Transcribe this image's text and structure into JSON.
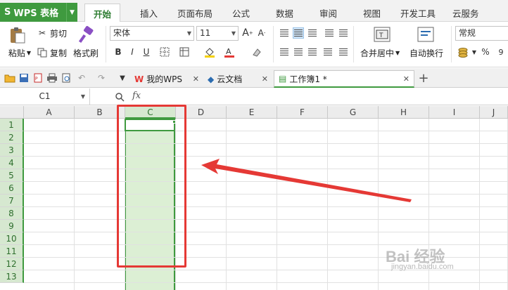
{
  "app": {
    "logo": "S",
    "title": "WPS 表格"
  },
  "menu": {
    "tabs": [
      "开始",
      "插入",
      "页面布局",
      "公式",
      "数据",
      "审阅",
      "视图",
      "开发工具",
      "云服务"
    ]
  },
  "ribbon": {
    "paste": "粘贴",
    "cut": "剪切",
    "copy": "复制",
    "format_painter": "格式刷",
    "font_name": "宋体",
    "font_size": "11",
    "bold": "B",
    "italic": "I",
    "underline": "U",
    "merge_center": "合并居中",
    "wrap_text": "自动换行",
    "number_format": "常规",
    "percent": "%",
    "comma": "9"
  },
  "doc_tabs": [
    {
      "label": "我的WPS"
    },
    {
      "label": "云文档"
    },
    {
      "label": "工作簿1 *"
    }
  ],
  "formula_bar": {
    "cell_ref": "C1",
    "fx": "fx"
  },
  "sheet": {
    "columns": [
      "A",
      "B",
      "C",
      "D",
      "E",
      "F",
      "G",
      "H",
      "I",
      "J"
    ],
    "rows": [
      "1",
      "2",
      "3",
      "4",
      "5",
      "6",
      "7",
      "8",
      "9",
      "10",
      "11",
      "12",
      "13"
    ],
    "selected_column": "C",
    "active_cell": "C1"
  },
  "colors": {
    "accent": "#3f9a3f",
    "highlight": "#dcefd4",
    "annotation": "#e53935"
  },
  "watermark": {
    "main": "Bai 经验",
    "sub": "jingyan.baidu.com"
  }
}
